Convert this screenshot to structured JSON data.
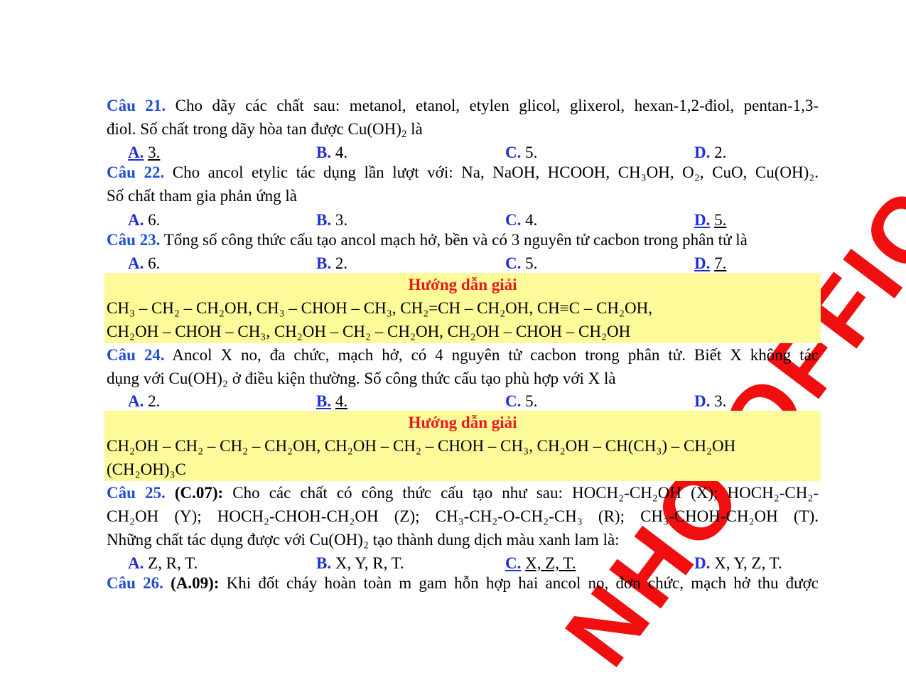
{
  "watermark": "NHO OFFICIAL",
  "q21": {
    "num": "Câu 21.",
    "line1": "Cho dãy các chất sau: metanol, etanol, etylen glicol, glixerol, hexan-1,2-điol, pentan-1,3-",
    "line2a": "điol. Số chất trong dãy hòa tan được Cu(OH)",
    "line2sub": "2",
    "line2b": " là",
    "options": [
      {
        "label": "A.",
        "value": "3.",
        "correct": true
      },
      {
        "label": "B.",
        "value": "4.",
        "correct": false
      },
      {
        "label": "C.",
        "value": "5.",
        "correct": false
      },
      {
        "label": "D.",
        "value": "2.",
        "correct": false
      }
    ]
  },
  "q22": {
    "num": "Câu 22.",
    "line1": "Cho ancol etylic tác dụng lần lượt với: Na, NaOH, HCOOH, CH₃OH, O₂, CuO, Cu(OH)₂.",
    "line2": "Số chất tham gia phản ứng là",
    "options": [
      {
        "label": "A.",
        "value": "6.",
        "correct": false
      },
      {
        "label": "B.",
        "value": "3.",
        "correct": false
      },
      {
        "label": "C.",
        "value": "4.",
        "correct": false
      },
      {
        "label": "D.",
        "value": "5.",
        "correct": true
      }
    ]
  },
  "q23": {
    "num": "Câu 23.",
    "line1": "Tổng số công thức cấu tạo ancol mạch hở, bền và có 3 nguyên tử cacbon trong phân tử là",
    "options": [
      {
        "label": "A.",
        "value": "6.",
        "correct": false
      },
      {
        "label": "B.",
        "value": "2.",
        "correct": false
      },
      {
        "label": "C.",
        "value": "5.",
        "correct": false
      },
      {
        "label": "D.",
        "value": "7.",
        "correct": true
      }
    ],
    "solution_title": "Hướng dẫn giải",
    "solution_line1": "CH₃ – CH₂ – CH₂OH, CH₃ – CHOH – CH₃, CH₂=CH – CH₂OH, CH≡C – CH₂OH,",
    "solution_line2": "CH₂OH – CHOH – CH₃, CH₂OH – CH₂ – CH₂OH, CH₂OH – CHOH – CH₂OH"
  },
  "q24": {
    "num": "Câu 24.",
    "line1": "Ancol X no, đa chức, mạch hở, có 4 nguyên tử cacbon trong phân tử. Biết X không tác",
    "line2": "dụng với Cu(OH)₂ ở điều kiện thường. Số công thức cấu tạo phù hợp với X là",
    "options": [
      {
        "label": "A.",
        "value": "2.",
        "correct": false
      },
      {
        "label": "B.",
        "value": "4.",
        "correct": true
      },
      {
        "label": "C.",
        "value": "5.",
        "correct": false
      },
      {
        "label": "D.",
        "value": "3.",
        "correct": false
      }
    ],
    "solution_title": "Hướng dẫn giải",
    "solution_line1": "CH₂OH – CH₂ – CH₂ – CH₂OH, CH₂OH – CH₂ – CHOH – CH₃, CH₂OH – CH(CH₃) – CH₂OH",
    "solution_line2": "(CH₂OH)₃C"
  },
  "q25": {
    "num": "Câu 25.",
    "source": "(C.07):",
    "line1": "Cho các chất có công thức cấu tạo như sau: HOCH₂-CH₂OH (X); HOCH₂-CH₂-",
    "line2": "CH₂OH (Y); HOCH₂-CHOH-CH₂OH (Z); CH₃-CH₂-O-CH₂-CH₃ (R); CH₃-CHOH-CH₂OH (T).",
    "line3": "Những chất tác dụng được với Cu(OH)₂ tạo thành dung dịch màu xanh lam là:",
    "options": [
      {
        "label": "A.",
        "value": "Z, R, T.",
        "correct": false
      },
      {
        "label": "B.",
        "value": "X, Y, R, T.",
        "correct": false
      },
      {
        "label": "C.",
        "value": "X, Z, T.",
        "correct": true
      },
      {
        "label": "D.",
        "value": "X, Y, Z, T.",
        "correct": false
      }
    ]
  },
  "q26": {
    "num": "Câu 26.",
    "source": "(A.09):",
    "line1": "Khi đốt cháy hoàn toàn m gam hỗn hợp hai ancol no, đơn chức, mạch hở thu được"
  }
}
